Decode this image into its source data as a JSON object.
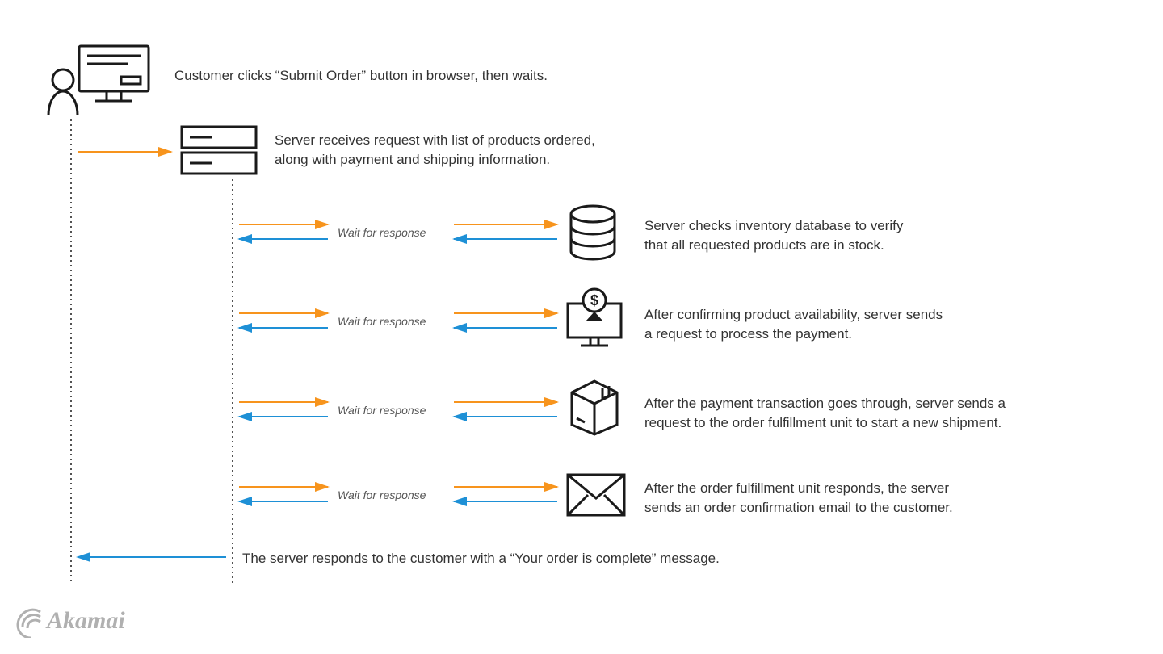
{
  "steps": {
    "customer": "Customer clicks “Submit Order” button in browser, then waits.",
    "server_receive_line1": "Server receives request with list of products ordered,",
    "server_receive_line2": "along with payment and shipping information.",
    "inventory_line1": "Server checks inventory database to verify",
    "inventory_line2": "that all requested products are in stock.",
    "payment_line1": "After confirming product availability, server sends",
    "payment_line2": "a request to process the payment.",
    "fulfillment_line1": "After the payment transaction goes through, server sends a",
    "fulfillment_line2": "request to the order fulfillment unit to start a new shipment.",
    "email_line1": "After the order fulfillment unit responds, the server",
    "email_line2": "sends an order confirmation email to the customer.",
    "final": "The server responds to the customer with a “Your order is complete” message."
  },
  "labels": {
    "wait": "Wait for response"
  },
  "brand": "Akamai",
  "colors": {
    "orange": "#f7941d",
    "blue": "#1e90d6",
    "ink": "#1a1a1a",
    "text": "#333"
  }
}
